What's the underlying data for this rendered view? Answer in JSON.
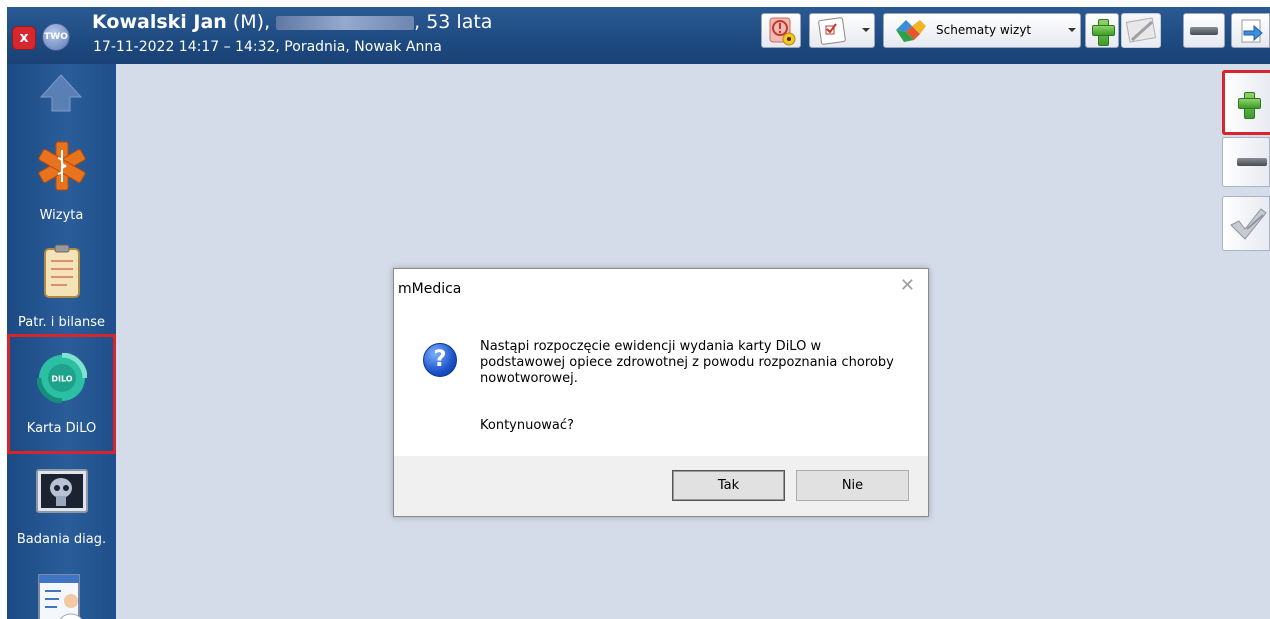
{
  "header": {
    "patient_name": "Kowalski Jan",
    "patient_sex": " (M),",
    "patient_age": ", 53 lata",
    "visit_info": "17-11-2022 14:17 – 14:32, Poradnia, Nowak Anna",
    "close_label": "x",
    "status_label": "TWO"
  },
  "toolbar": {
    "schematy_label": "Schematy wizyt"
  },
  "sidebar": {
    "items": [
      {
        "label": "Wizyta",
        "icon": "medical-star-icon"
      },
      {
        "label": "Patr. i bilanse",
        "icon": "clipboard-icon"
      },
      {
        "label": "Karta DiLO",
        "icon": "dilo-icon",
        "highlighted": true
      },
      {
        "label": "Badania diag.",
        "icon": "xray-icon"
      },
      {
        "label": "",
        "icon": "doctor-form-icon"
      }
    ],
    "dilo_badge": "DILO"
  },
  "dialog": {
    "title": "mMedica",
    "message": "Nastąpi rozpoczęcie ewidencji wydania karty DiLO w podstawowej opiece zdrowotnej z powodu rozpoznania choroby nowotworowej.",
    "question": "Kontynuować?",
    "yes_label": "Tak",
    "no_label": "Nie",
    "close_glyph": "✕",
    "icon_glyph": "?"
  },
  "colors": {
    "header_bg": "#1d4a80",
    "sidebar_bg": "#2a5d99",
    "workspace_bg": "#d4dbe9",
    "highlight": "#d8242c"
  }
}
